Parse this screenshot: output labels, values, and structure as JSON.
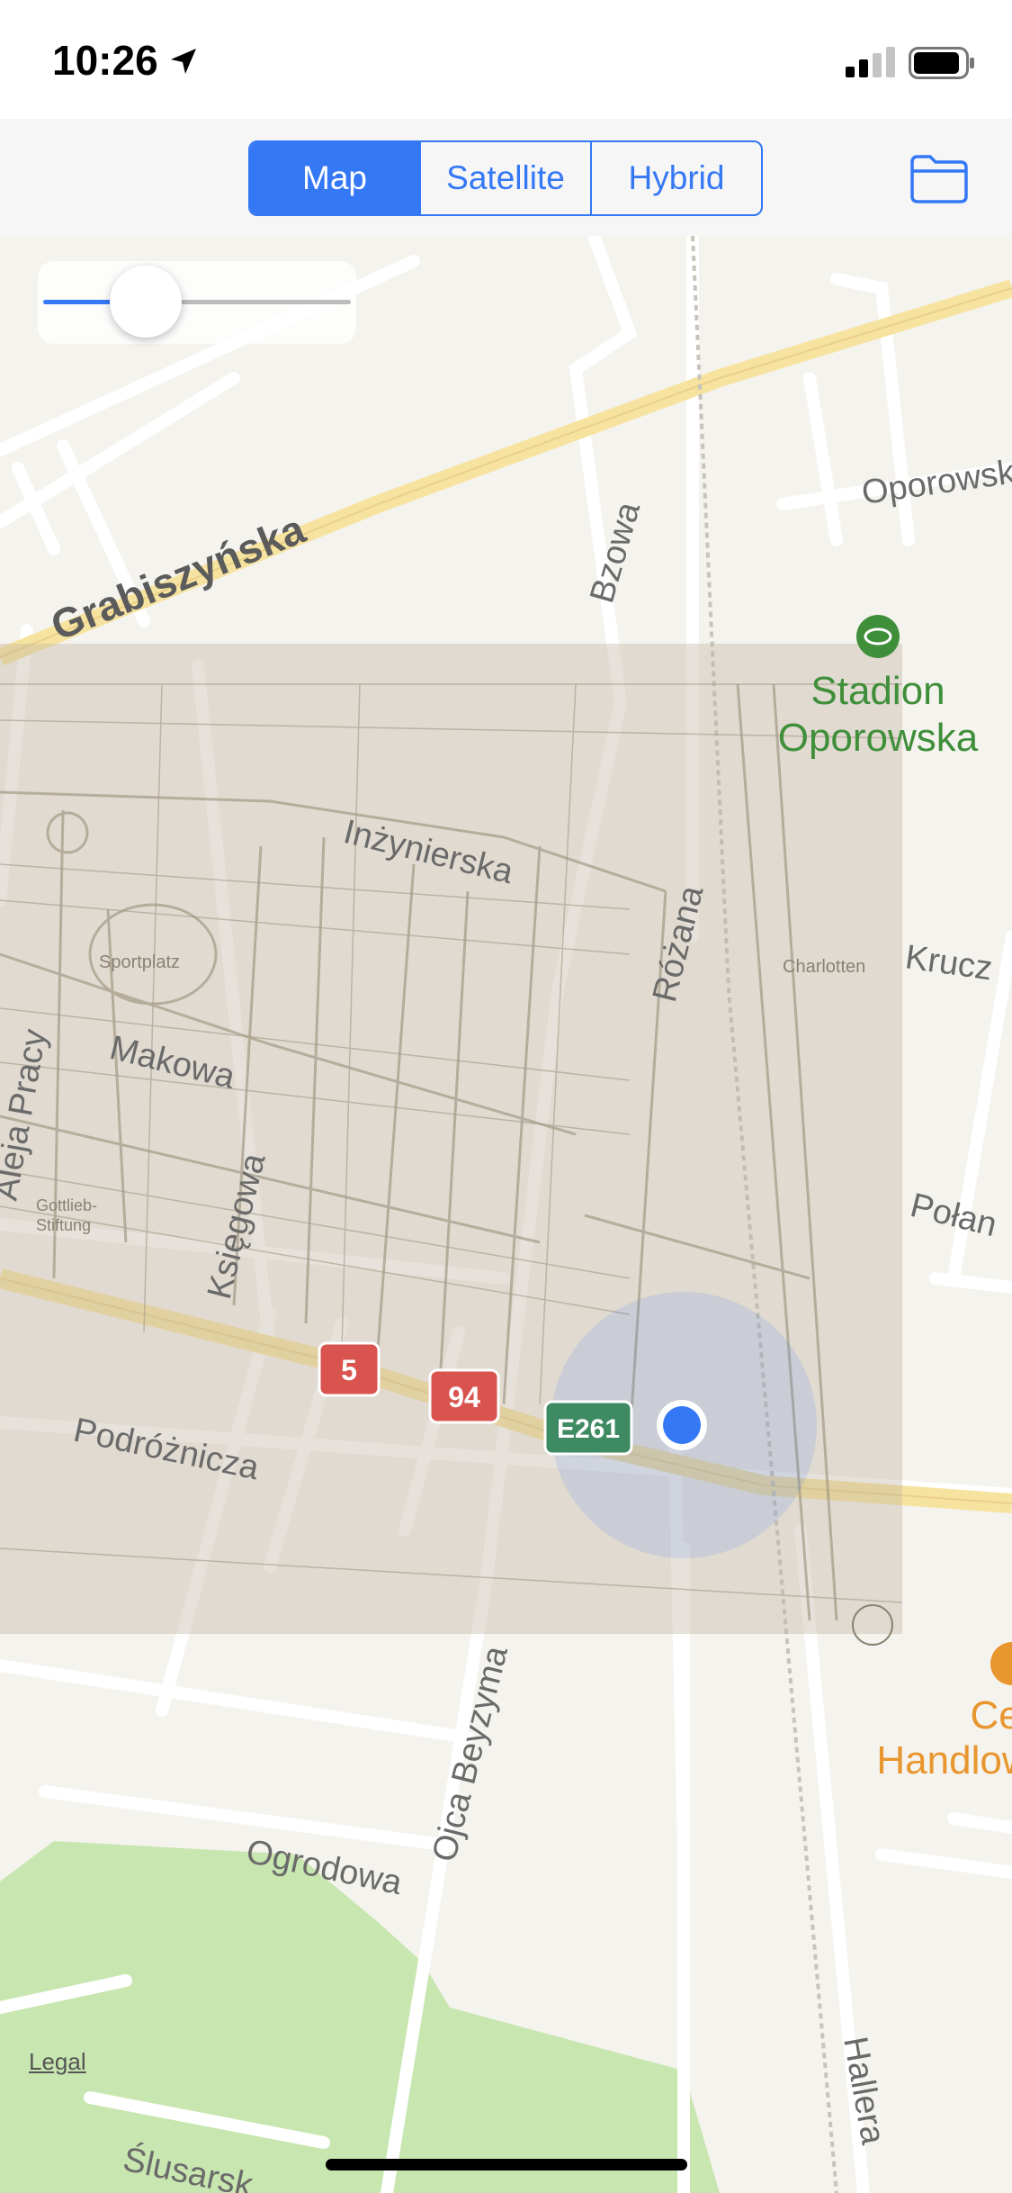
{
  "status_bar": {
    "time": "10:26"
  },
  "toolbar": {
    "segments": [
      {
        "label": "Map",
        "selected": true
      },
      {
        "label": "Satellite",
        "selected": false
      },
      {
        "label": "Hybrid",
        "selected": false
      }
    ]
  },
  "map": {
    "roads": {
      "grabiszynska": "Grabiszyńska",
      "oporowska": "Oporowska",
      "bzowa": "Bzowa",
      "inzynierska": "Inżynierska",
      "rozana": "Różana",
      "kruczkowskiego": "Krucz",
      "aleja_pracy": "Aleja Pracy",
      "makowa": "Makowa",
      "ksiegowa": "Księgowa",
      "polanka": "Połan",
      "podroznicza": "Podróżnicza",
      "ojca_beyzyma": "Ojca Beyzyma",
      "ogrodowa": "Ogrodowa",
      "hallera": "Hallera",
      "slusarska": "Ślusarsk"
    },
    "pois": {
      "stadion_line1": "Stadion",
      "stadion_line2": "Oporowska",
      "centrum_line1": "Cent",
      "centrum_line2": "Handlow"
    },
    "route_shields": {
      "route_5": "5",
      "route_94": "94",
      "route_e261": "E261"
    },
    "overlay_labels": {
      "sportplatz": "Sportplatz",
      "gottlieb": "Gottlieb-",
      "stiftung": "Stiftung",
      "charlotten": "Charlotten"
    },
    "overlay_opacity_fraction": 0.35,
    "legal": "Legal"
  },
  "colors": {
    "accent": "#3478f6",
    "map_background": "#f5f3ee",
    "road_major": "#f7e3a0",
    "park": "#c8e6b0",
    "stadium_green": "#3f8f3a",
    "poi_orange": "#e8962e",
    "route_red": "#d9534f",
    "route_green": "#3d8a63"
  }
}
